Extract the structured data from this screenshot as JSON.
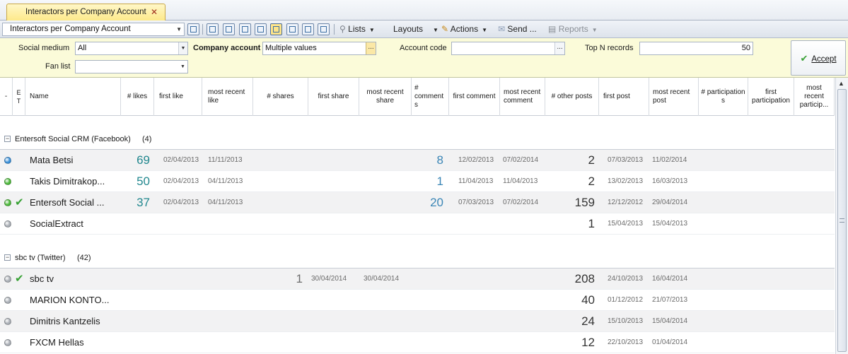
{
  "tab": {
    "title": "Interactors per Company Account",
    "close": "✕"
  },
  "toolbar": {
    "view_name": "Interactors per Company Account",
    "lists_label": "Lists",
    "layouts_label": "Layouts",
    "actions_label": "Actions",
    "send_label": "Send ...",
    "reports_label": "Reports"
  },
  "filters": {
    "social_medium_label": "Social medium",
    "social_medium_value": "All",
    "company_account_label": "Company account",
    "company_account_value": "Multiple values",
    "account_code_label": "Account code",
    "account_code_value": "",
    "top_n_label": "Top N records",
    "top_n_value": "50",
    "fan_list_label": "Fan list",
    "fan_list_value": "",
    "accept_label": "Accept"
  },
  "columns": {
    "dash": "-",
    "et": "E T",
    "name": "Name",
    "likes": "# likes",
    "first_like": "first like",
    "recent_like": "most recent like",
    "shares": "# shares",
    "first_share": "first share",
    "recent_share": "most recent share",
    "comments": "# comment s",
    "first_comment": "first comment",
    "recent_comment": "most recent comment",
    "other_posts": "# other posts",
    "first_post": "first post",
    "recent_post": "most recent post",
    "participations": "# participation s",
    "first_participation": "first participation",
    "recent_participation": "most recent particip..."
  },
  "groups": [
    {
      "title": "Entersoft Social CRM (Facebook)",
      "count": "(4)",
      "rows": [
        {
          "status_color": "#3a8fd8",
          "checked": false,
          "name": "Mata Betsi",
          "likes": "69",
          "first_like": "02/04/2013",
          "recent_like": "11/11/2013",
          "shares": "",
          "first_share": "",
          "recent_share": "",
          "comments": "8",
          "first_comment": "12/02/2013",
          "recent_comment": "07/02/2014",
          "other_posts": "2",
          "first_post": "07/03/2013",
          "recent_post": "11/02/2014"
        },
        {
          "status_color": "#4cb83a",
          "checked": false,
          "name": "Takis Dimitrakop...",
          "likes": "50",
          "first_like": "02/04/2013",
          "recent_like": "04/11/2013",
          "shares": "",
          "first_share": "",
          "recent_share": "",
          "comments": "1",
          "first_comment": "11/04/2013",
          "recent_comment": "11/04/2013",
          "other_posts": "2",
          "first_post": "13/02/2013",
          "recent_post": "16/03/2013"
        },
        {
          "status_color": "#4cb83a",
          "checked": true,
          "name": "Entersoft Social ...",
          "likes": "37",
          "first_like": "02/04/2013",
          "recent_like": "04/11/2013",
          "shares": "",
          "first_share": "",
          "recent_share": "",
          "comments": "20",
          "first_comment": "07/03/2013",
          "recent_comment": "07/02/2014",
          "other_posts": "159",
          "first_post": "12/12/2012",
          "recent_post": "29/04/2014"
        },
        {
          "status_color": "#a9aeb5",
          "checked": false,
          "name": "SocialExtract",
          "likes": "",
          "first_like": "",
          "recent_like": "",
          "shares": "",
          "first_share": "",
          "recent_share": "",
          "comments": "",
          "first_comment": "",
          "recent_comment": "",
          "other_posts": "1",
          "first_post": "15/04/2013",
          "recent_post": "15/04/2013"
        }
      ]
    },
    {
      "title": "sbc tv (Twitter)",
      "count": "(42)",
      "rows": [
        {
          "status_color": "#a9aeb5",
          "checked": true,
          "name": "sbc tv",
          "likes": "",
          "first_like": "",
          "recent_like": "",
          "shares": "1",
          "first_share": "30/04/2014",
          "recent_share": "30/04/2014",
          "comments": "",
          "first_comment": "",
          "recent_comment": "",
          "other_posts": "208",
          "first_post": "24/10/2013",
          "recent_post": "16/04/2014"
        },
        {
          "status_color": "#a9aeb5",
          "checked": false,
          "name": "MARION KONTO...",
          "likes": "",
          "first_like": "",
          "recent_like": "",
          "shares": "",
          "first_share": "",
          "recent_share": "",
          "comments": "",
          "first_comment": "",
          "recent_comment": "",
          "other_posts": "40",
          "first_post": "01/12/2012",
          "recent_post": "21/07/2013"
        },
        {
          "status_color": "#a9aeb5",
          "checked": false,
          "name": "Dimitris Kantzelis",
          "likes": "",
          "first_like": "",
          "recent_like": "",
          "shares": "",
          "first_share": "",
          "recent_share": "",
          "comments": "",
          "first_comment": "",
          "recent_comment": "",
          "other_posts": "24",
          "first_post": "15/10/2013",
          "recent_post": "15/04/2014"
        },
        {
          "status_color": "#a9aeb5",
          "checked": false,
          "name": "FXCM Hellas",
          "likes": "",
          "first_like": "",
          "recent_like": "",
          "shares": "",
          "first_share": "",
          "recent_share": "",
          "comments": "",
          "first_comment": "",
          "recent_comment": "",
          "other_posts": "12",
          "first_post": "22/10/2013",
          "recent_post": "01/04/2014"
        }
      ]
    }
  ]
}
